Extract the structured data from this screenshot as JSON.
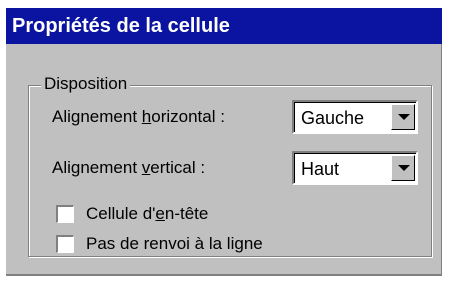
{
  "dialog": {
    "title": "Propriétés de la cellule"
  },
  "disposition": {
    "legend": "Disposition",
    "horizontal": {
      "label_before": "Alignement ",
      "label_mnemonic": "h",
      "label_after": "orizontal :",
      "value": "Gauche"
    },
    "vertical": {
      "label_before": "Alignement ",
      "label_mnemonic": "v",
      "label_after": "ertical :",
      "value": "Haut"
    },
    "header_cell": {
      "label_before": "Cellule d'",
      "label_mnemonic": "e",
      "label_after": "n-tête",
      "checked": false
    },
    "no_wrap": {
      "label": "Pas de renvoi à la ligne",
      "checked": false
    }
  },
  "colors": {
    "titlebar": "#0a14a0",
    "face": "#c0c0c0"
  }
}
